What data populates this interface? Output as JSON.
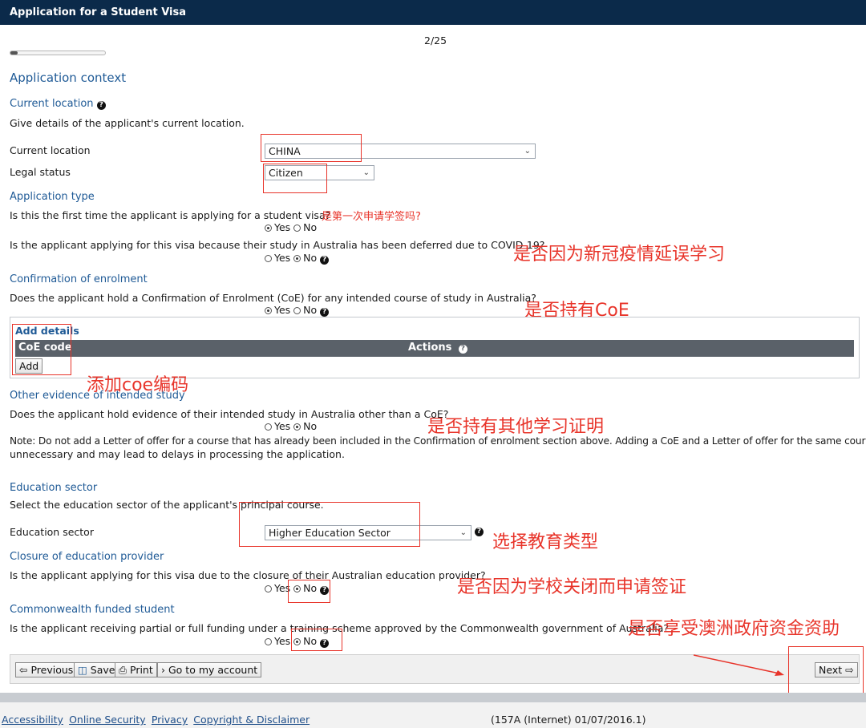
{
  "window": {
    "title": "Application for a Student Visa"
  },
  "progress": {
    "label": "2/25",
    "fraction": 0.08
  },
  "page_heading": "Application context",
  "current_location_section": {
    "title": "Current location",
    "description": "Give details of the applicant's current location.",
    "location_label": "Current location",
    "location_value": "CHINA",
    "legal_status_label": "Legal status",
    "legal_status_value": "Citizen"
  },
  "application_type": {
    "title": "Application type",
    "q1": "Is this the first time the applicant is applying for a student visa?",
    "q1_annotation": "是第一次申请学签吗?",
    "q2": "Is the applicant applying for this visa because their study in Australia has been deferred due to COVID-19?",
    "q2_annotation": "是否因为新冠疫情延误学习"
  },
  "radio": {
    "yes": "Yes",
    "no": "No"
  },
  "coe": {
    "title": "Confirmation of enrolment",
    "question": "Does the applicant hold a Confirmation of Enrolment (CoE) for any intended course of study in Australia?",
    "annotation": "是否持有CoE",
    "add_details": "Add details",
    "col_code": "CoE code",
    "col_actions": "Actions",
    "add_button": "Add",
    "add_annotation": "添加coe编码"
  },
  "other_evidence": {
    "title": "Other evidence of intended study",
    "question": "Does the applicant hold evidence of their intended study in Australia other than a CoE?",
    "annotation": "是否持有其他学习证明",
    "note_line1": "Note: Do not add a Letter of offer for a course that has already been included in the Confirmation of enrolment section above. Adding a CoE and a Letter of offer for the same course is",
    "note_line2": "unnecessary and may lead to delays in processing the application."
  },
  "education_sector": {
    "title": "Education sector",
    "description": "Select the education sector of the applicant's principal course.",
    "label": "Education sector",
    "value": "Higher Education Sector",
    "annotation": "选择教育类型"
  },
  "closure": {
    "title": "Closure of education provider",
    "question": "Is the applicant applying for this visa due to the closure of their Australian education provider?",
    "annotation": "是否因为学校关闭而申请签证"
  },
  "commonwealth": {
    "title": "Commonwealth funded student",
    "question": "Is the applicant receiving partial or full funding under a training scheme approved by the Commonwealth government of Australia?",
    "annotation": "是否享受澳洲政府资金资助"
  },
  "toolbar": {
    "previous": "Previous",
    "save": "Save",
    "print": "Print",
    "account": "Go to my account",
    "next": "Next"
  },
  "footer": {
    "links": [
      "Accessibility",
      "Online Security",
      "Privacy",
      "Copyright & Disclaimer"
    ],
    "version": "(157A (Internet) 01/07/2016.1)"
  },
  "colors": {
    "header": "#0b2a4a",
    "section_title": "#1f5a96",
    "annotation": "#e8342a"
  }
}
